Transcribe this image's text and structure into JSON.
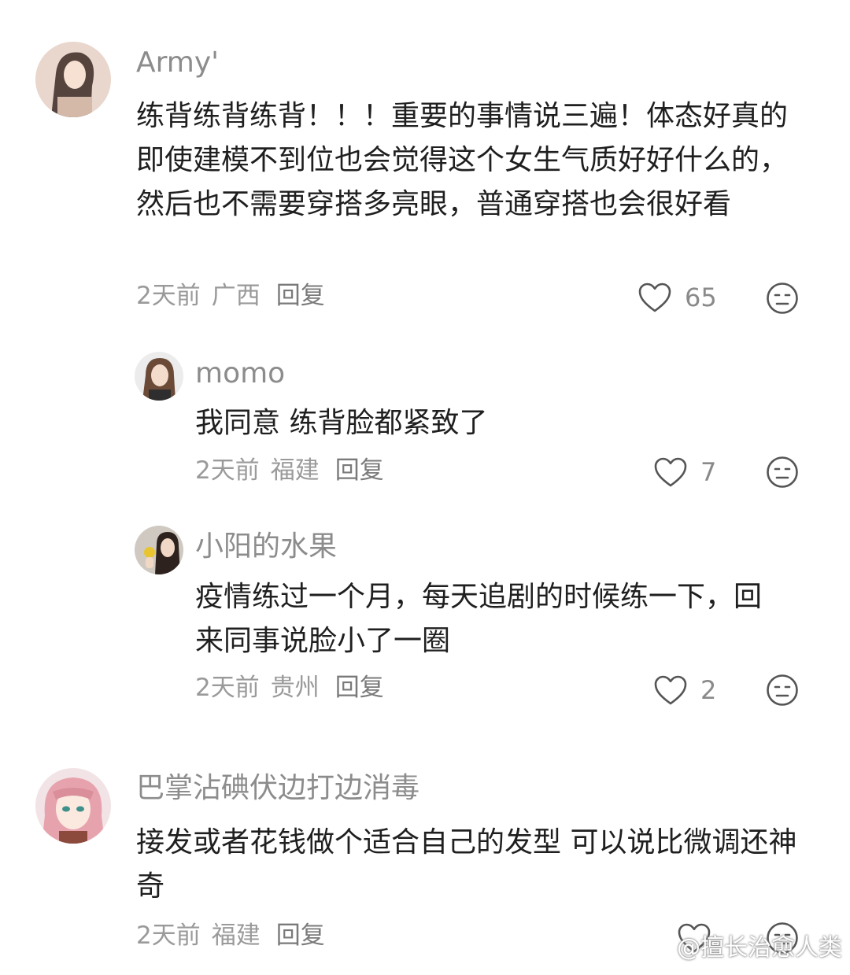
{
  "comments": [
    {
      "username": "Army'",
      "text": "练背练背练背！！！重要的事情说三遍！体态好真的即使建模不到位也会觉得这个女生气质好好什么的，然后也不需要穿搭多亮眼，普通穿搭也会很好看",
      "time": "2天前",
      "location": "广西",
      "reply": "回复",
      "likes": "65"
    },
    {
      "username": "momo",
      "text": "我同意 练背脸都紧致了",
      "time": "2天前",
      "location": "福建",
      "reply": "回复",
      "likes": "7"
    },
    {
      "username": "小阳的水果",
      "text": "疫情练过一个月，每天追剧的时候练一下，回来同事说脸小了一圈",
      "time": "2天前",
      "location": "贵州",
      "reply": "回复",
      "likes": "2"
    },
    {
      "username": "巴掌沾碘伏边打边消毒",
      "text": "接发或者花钱做个适合自己的发型 可以说比微调还神奇",
      "time": "2天前",
      "location": "福建",
      "reply": "回复",
      "likes": ""
    }
  ],
  "icons": {
    "like": "heart-outline-icon",
    "dislike": "meh-face-icon",
    "watermark": "weibo-logo-icon"
  },
  "watermark": {
    "text": "@擅长治愈人类"
  },
  "colors": {
    "username": "#8c8c8c",
    "meta": "#9a9a9a",
    "text": "#1f1f1f",
    "icon": "#555555"
  }
}
